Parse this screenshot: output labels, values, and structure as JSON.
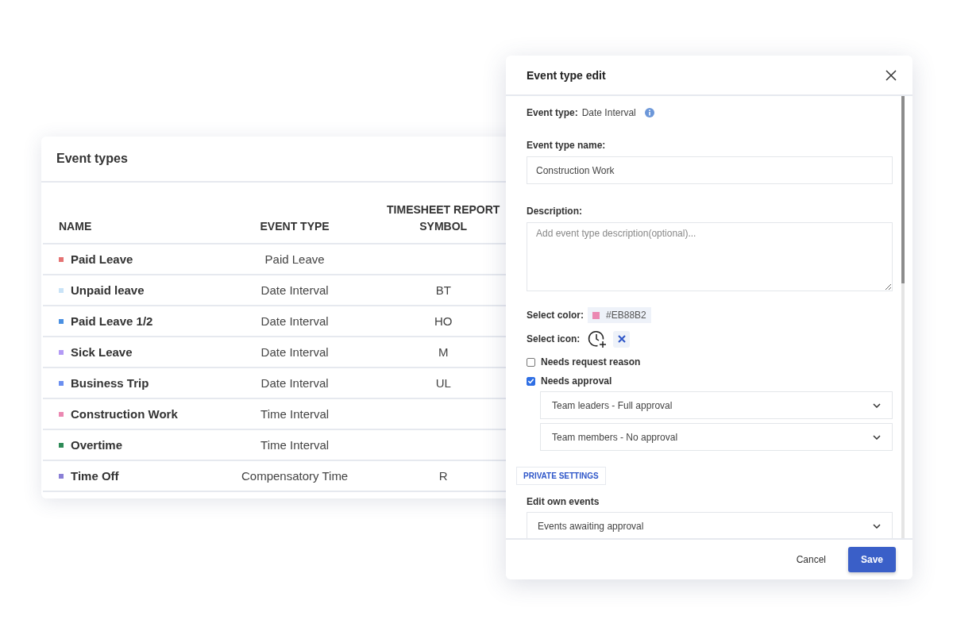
{
  "table_panel": {
    "title": "Event types",
    "columns": [
      "NAME",
      "EVENT TYPE",
      "TIMESHEET REPORT SYMBOL"
    ],
    "rows": [
      {
        "name": "Paid Leave",
        "color": "#e57373",
        "event_type": "Paid Leave"
      },
      {
        "name": "Unpaid leave",
        "color": "#c9e3f7",
        "event_type": "Date Interval",
        "symbol": "BT"
      },
      {
        "name": "Paid Leave 1/2",
        "color": "#4a90e2",
        "event_type": "Date Interval",
        "symbol": "HO"
      },
      {
        "name": "Sick Leave",
        "color": "#b39af5",
        "event_type": "Date Interval",
        "symbol": "M"
      },
      {
        "name": "Business Trip",
        "color": "#6b8ff0",
        "event_type": "Date Interval",
        "symbol": "UL"
      },
      {
        "name": "Construction Work",
        "color": "#eb88b2",
        "event_type": "Time Interval"
      },
      {
        "name": "Overtime",
        "color": "#2e8b57",
        "event_type": "Time Interval"
      },
      {
        "name": "Time Off",
        "color": "#8a7fd6",
        "event_type": "Compensatory Time",
        "symbol": "R"
      }
    ]
  },
  "dialog": {
    "title": "Event type edit",
    "event_type_label": "Event type:",
    "event_type_value": "Date Interval",
    "name_label": "Event type name:",
    "name_value": "Construction Work",
    "description_label": "Description:",
    "description_placeholder": "Add event type description(optional)...",
    "color_label": "Select color:",
    "color_value": "#EB88B2",
    "icon_label": "Select icon:",
    "checkboxes": [
      {
        "label": "Needs request reason",
        "checked": false
      },
      {
        "label": "Needs approval",
        "checked": true
      }
    ],
    "approval_selects": [
      "Team leaders - Full approval",
      "Team members - No approval"
    ],
    "section_tab": "PRIVATE SETTINGS",
    "edit_own_label": "Edit own events",
    "edit_own_value": "Events awaiting approval",
    "cancel": "Cancel",
    "save": "Save"
  }
}
